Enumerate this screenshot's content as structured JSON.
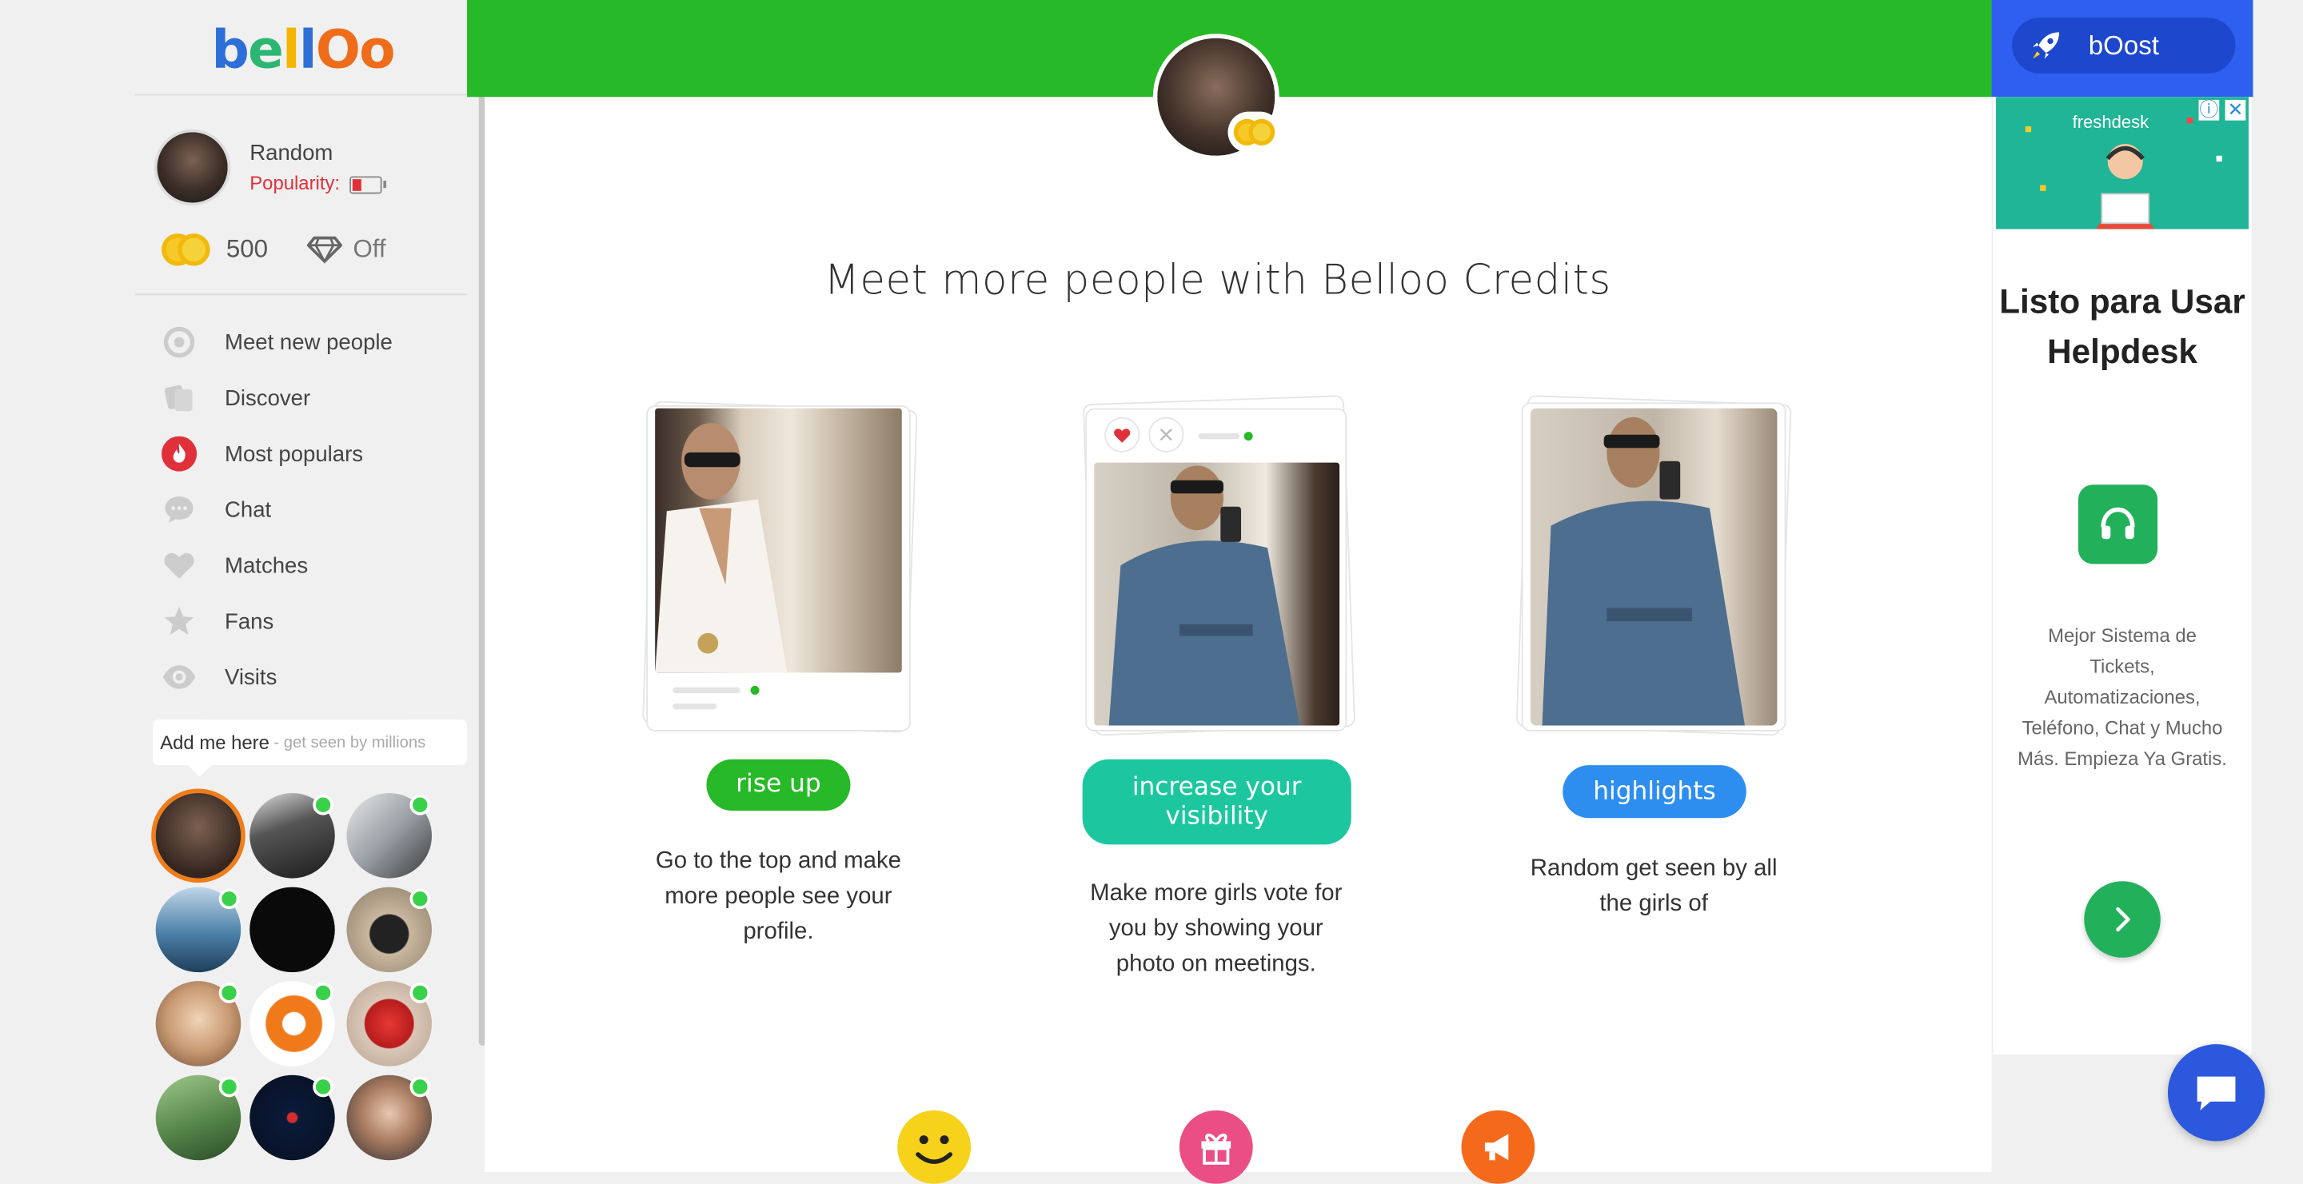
{
  "brand": {
    "logo_text": "belloo"
  },
  "user": {
    "name": "Random",
    "popularity_label": "Popularity:",
    "popularity_level": 0.3,
    "credits": "500",
    "vip_status": "Off"
  },
  "nav": {
    "items": [
      {
        "label": "Meet new people",
        "icon": "target-icon"
      },
      {
        "label": "Discover",
        "icon": "cards-icon"
      },
      {
        "label": "Most populars",
        "icon": "fire-icon"
      },
      {
        "label": "Chat",
        "icon": "chat-bubble-icon"
      },
      {
        "label": "Matches",
        "icon": "heart-icon"
      },
      {
        "label": "Fans",
        "icon": "star-icon"
      },
      {
        "label": "Visits",
        "icon": "eye-icon"
      }
    ]
  },
  "spotlight": {
    "main": "Add me here",
    "sub": "- get seen by millions"
  },
  "main": {
    "title": "Meet more people with Belloo Credits",
    "features": [
      {
        "button": "rise up",
        "description": "Go to the top and make more people see your profile.",
        "color": "#27b927"
      },
      {
        "button": "increase your visibility",
        "description": "Make more girls vote for you by showing your photo on meetings.",
        "color": "#1cc7a0"
      },
      {
        "button": "highlights",
        "description": "Random get seen by all the girls of",
        "color": "#2e8ef0"
      }
    ]
  },
  "boost": {
    "label": "bOost"
  },
  "ad": {
    "brand": "freshdesk",
    "title": "Listo para Usar Helpdesk",
    "body": "Mejor Sistema de Tickets, Automatizaciones, Teléfono, Chat y Mucho Más. Empieza Ya Gratis."
  },
  "colors": {
    "header_green": "#27b927",
    "boost_blue": "#2e5ff0",
    "accent_red": "#e0313a"
  }
}
